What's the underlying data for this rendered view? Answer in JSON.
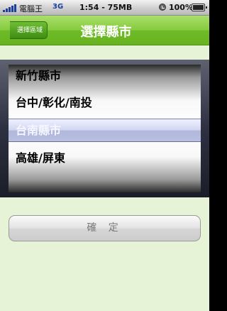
{
  "status_bar": {
    "carrier": "電腦王",
    "network": "3G",
    "time_memory": "1:54 - 75MB",
    "battery_label": "100%",
    "battery_level": 1.0,
    "icons": [
      "signal-bars-icon",
      "alarm-icon",
      "battery-icon"
    ]
  },
  "nav": {
    "back_label": "選擇區域",
    "title": "選擇縣市"
  },
  "picker": {
    "options": [
      "新竹縣市",
      "台中/彰化/南投",
      "台南縣市",
      "高雄/屏東"
    ],
    "selected": "台南縣市"
  },
  "confirm_label": "確 定",
  "colors": {
    "nav_green": "#7cc335",
    "background": "#e6f3d6",
    "selection_tint": "#a8b0d8"
  }
}
